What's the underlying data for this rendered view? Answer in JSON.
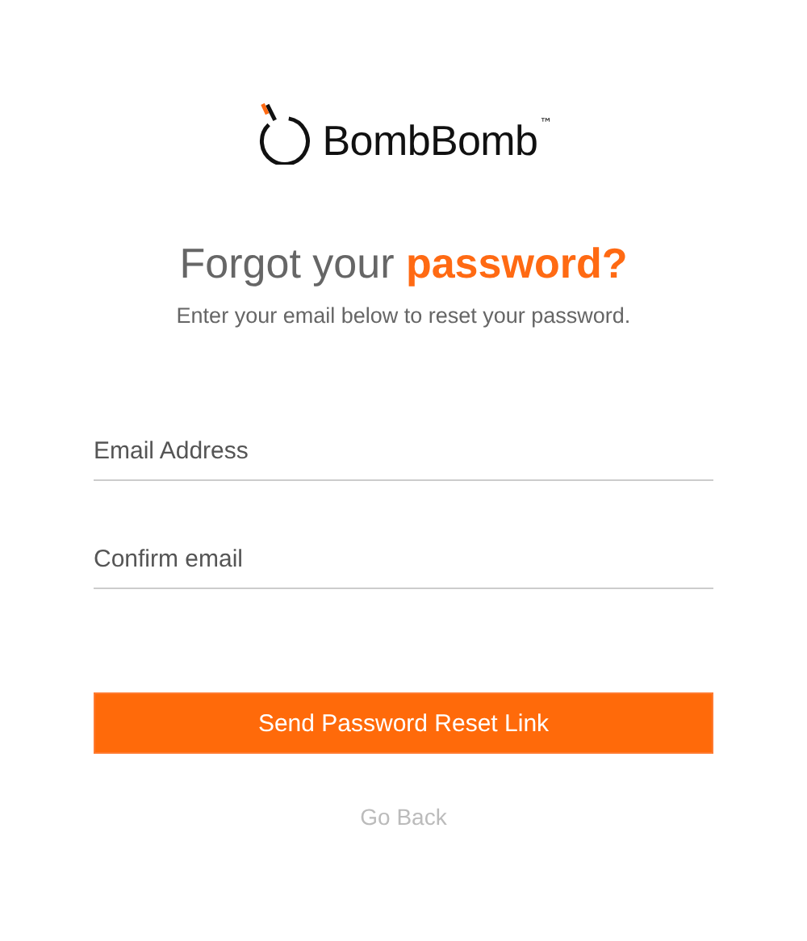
{
  "logo": {
    "text": "BombBomb",
    "trademark": "™"
  },
  "heading": "Forgot your **password?**",
  "subtitle": "Enter your email below to reset your password.",
  "fields": [
    {
      "placeholder": "Email Address"
    },
    {
      "placeholder": "Confirm email"
    }
  ],
  "submit_button": "Send Password Reset Link",
  "back_link": "Go Back"
}
